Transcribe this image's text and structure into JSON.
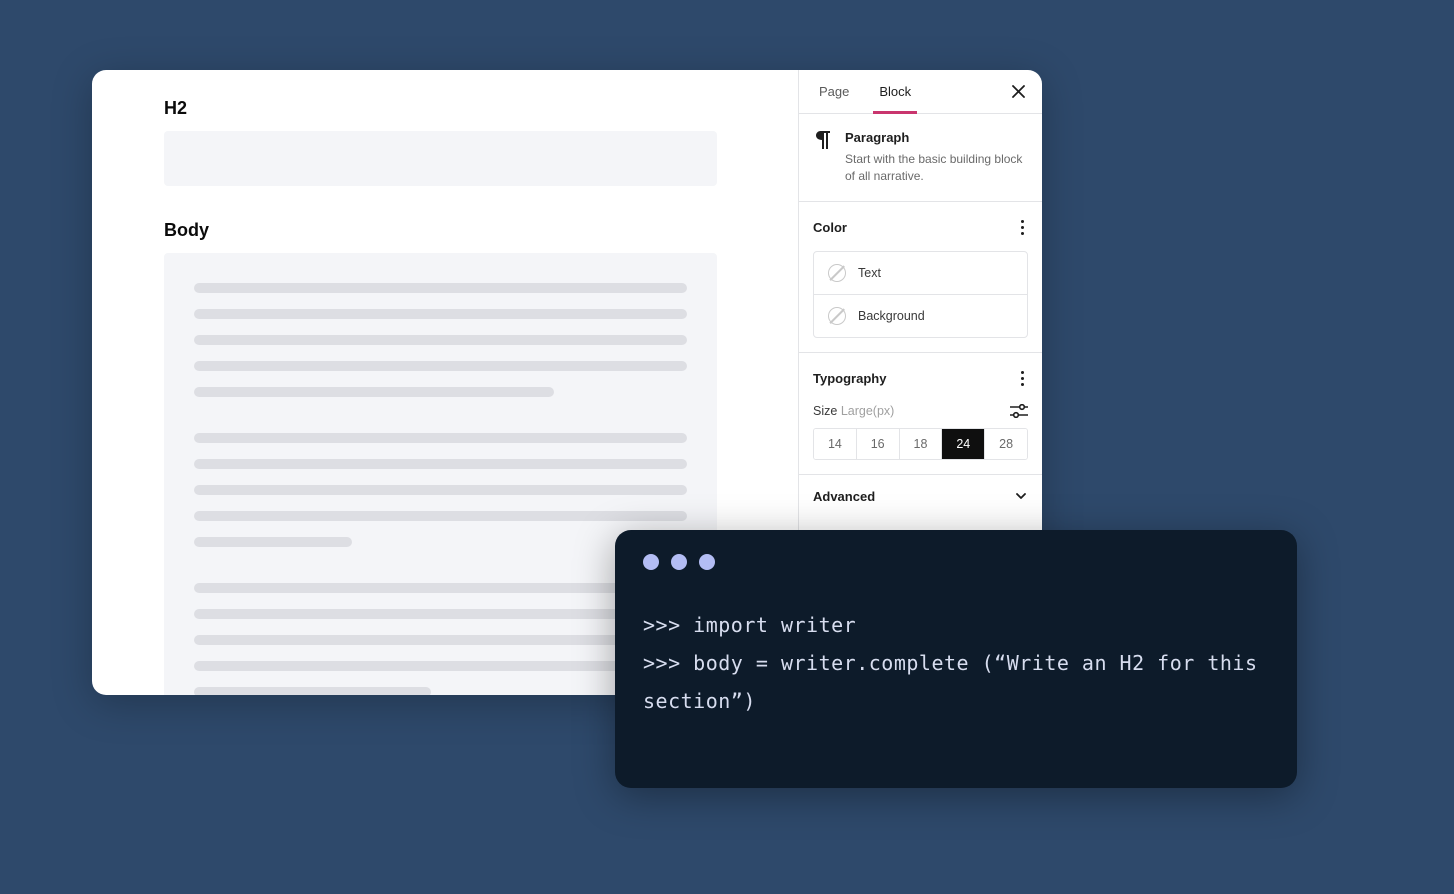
{
  "content": {
    "h2_label": "H2",
    "body_label": "Body"
  },
  "sidebar": {
    "tabs": {
      "page": "Page",
      "block": "Block"
    },
    "block_info": {
      "title": "Paragraph",
      "description": "Start with the basic building block of all narrative."
    },
    "color": {
      "heading": "Color",
      "text_label": "Text",
      "background_label": "Background"
    },
    "typography": {
      "heading": "Typography",
      "size_label": "Size",
      "size_detail": "Large(px)",
      "options": [
        "14",
        "16",
        "18",
        "24",
        "28"
      ],
      "active": "24"
    },
    "advanced_label": "Advanced"
  },
  "terminal": {
    "line1": ">>> import writer",
    "line2": ">>> body = writer.complete (“Write an H2 for this section”)"
  }
}
